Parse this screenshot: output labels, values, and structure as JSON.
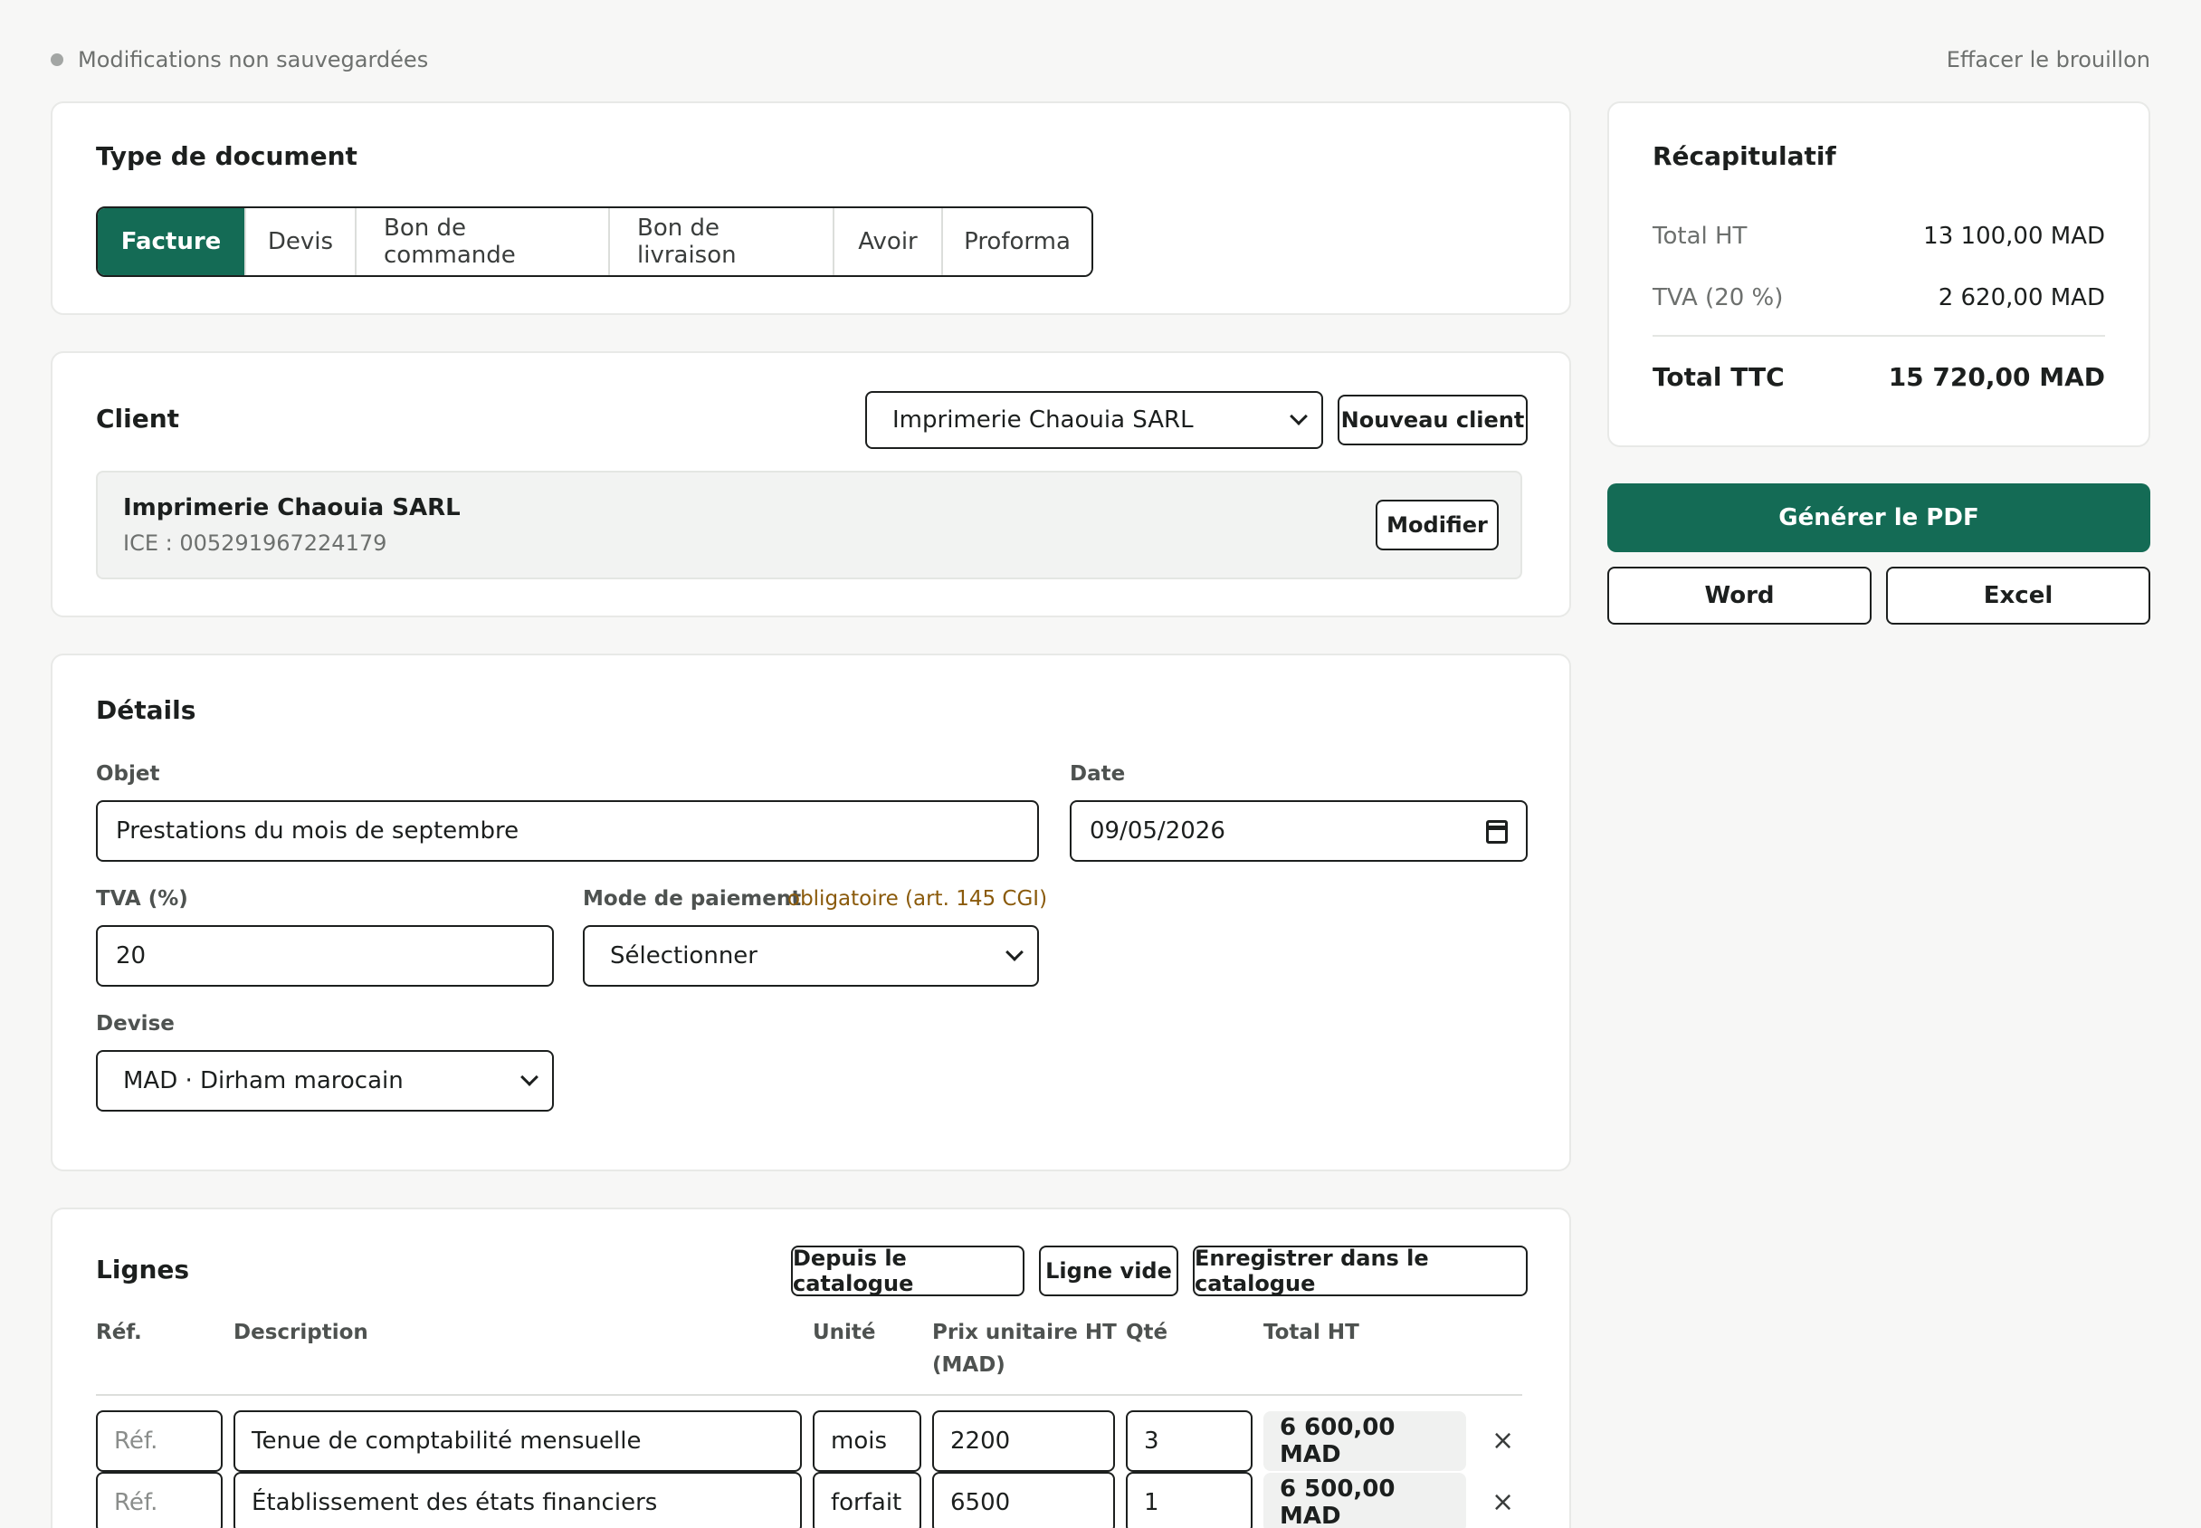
{
  "status": {
    "unsaved_label": "Modifications non sauvegardées",
    "clear_draft_label": "Effacer le brouillon"
  },
  "document_type": {
    "title": "Type de document",
    "options": [
      "Facture",
      "Devis",
      "Bon de commande",
      "Bon de livraison",
      "Avoir",
      "Proforma"
    ],
    "selected": "Facture"
  },
  "client": {
    "title": "Client",
    "selected": "Imprimerie Chaouia SARL",
    "new_button": "Nouveau client",
    "card": {
      "name": "Imprimerie Chaouia SARL",
      "ice": "ICE : 005291967224179",
      "edit_button": "Modifier"
    }
  },
  "details": {
    "title": "Détails",
    "objet_label": "Objet",
    "objet_value": "Prestations du mois de septembre",
    "date_label": "Date",
    "date_value": "09/05/2026",
    "tva_label": "TVA (%)",
    "tva_value": "20",
    "payment_label": "Mode de paiement",
    "payment_hint": "obligatoire (art. 145 CGI)",
    "payment_value": "Sélectionner",
    "currency_label": "Devise",
    "currency_value": "MAD · Dirham marocain"
  },
  "lines": {
    "title": "Lignes",
    "buttons": {
      "catalogue": "Depuis le catalogue",
      "empty": "Ligne vide",
      "save": "Enregistrer dans le catalogue"
    },
    "headers": {
      "ref": "Réf.",
      "description": "Description",
      "unit": "Unité",
      "price_1": "Prix unitaire HT",
      "price_2": "(MAD)",
      "qty": "Qté",
      "total": "Total HT"
    },
    "ref_placeholder": "Réf.",
    "rows": [
      {
        "description": "Tenue de comptabilité mensuelle",
        "unit": "mois",
        "price": "2200",
        "qty": "3",
        "total": "6 600,00 MAD"
      },
      {
        "description": "Établissement des états financiers",
        "unit": "forfait",
        "price": "6500",
        "qty": "1",
        "total": "6 500,00 MAD"
      }
    ],
    "remove_glyph": "×"
  },
  "summary": {
    "title": "Récapitulatif",
    "ht_label": "Total HT",
    "ht_value": "13 100,00 MAD",
    "tva_label": "TVA (20 %)",
    "tva_value": "2 620,00 MAD",
    "ttc_label": "Total TTC",
    "ttc_value": "15 720,00 MAD"
  },
  "export": {
    "pdf": "Générer le PDF",
    "word": "Word",
    "excel": "Excel"
  },
  "colors": {
    "accent": "#146b55",
    "hint": "#8a5a0b",
    "background": "#f7f7f6"
  }
}
